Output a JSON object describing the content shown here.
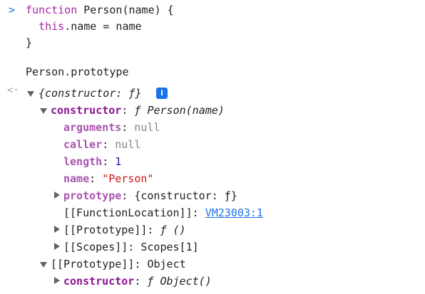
{
  "code": {
    "line1_kw": "function",
    "line1_rest": " Person(name) {",
    "line2_indent": "  ",
    "line2_kw": "this",
    "line2_rest": ".name = name",
    "line3": "}"
  },
  "expr": "Person.prototype",
  "tree": {
    "root_label": "{constructor: ƒ}",
    "info_badge": "i",
    "constructor": {
      "key": "constructor",
      "sep": ": ",
      "value": "ƒ Person(name)"
    },
    "arguments": {
      "key": "arguments",
      "sep": ": ",
      "value": "null"
    },
    "caller": {
      "key": "caller",
      "sep": ": ",
      "value": "null"
    },
    "length": {
      "key": "length",
      "sep": ": ",
      "value": "1"
    },
    "name": {
      "key": "name",
      "sep": ": ",
      "value": "\"Person\""
    },
    "prototype": {
      "key": "prototype",
      "sep": ": ",
      "value": "{constructor: ƒ}"
    },
    "function_location": {
      "key": "[[FunctionLocation]]",
      "sep": ": ",
      "value": "VM23003:1"
    },
    "fn_proto": {
      "key": "[[Prototype]]",
      "sep": ": ",
      "value": "ƒ ()"
    },
    "scopes": {
      "key": "[[Scopes]]",
      "sep": ": ",
      "value": "Scopes[1]"
    },
    "obj_proto": {
      "key": "[[Prototype]]",
      "sep": ": ",
      "value": "Object"
    },
    "obj_constructor": {
      "key": "constructor",
      "sep": ": ",
      "value": "ƒ Object()"
    }
  },
  "icons": {
    "prompt": "chevron-right-icon",
    "result": "result-arrow-icon"
  }
}
